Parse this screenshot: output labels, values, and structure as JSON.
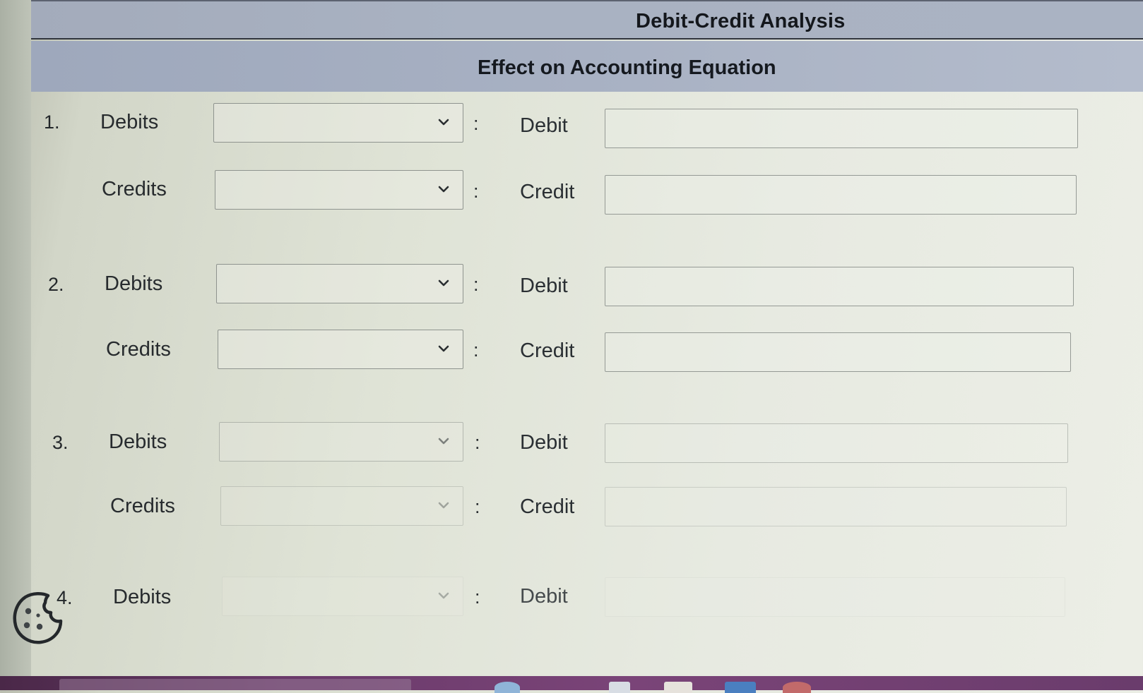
{
  "header": {
    "title": "Debit-Credit Analysis",
    "subtitle": "Effect on Accounting Equation"
  },
  "rows": [
    {
      "number": "1.",
      "debits_label": "Debits",
      "credits_label": "Credits",
      "debits_selected": "",
      "credits_selected": "",
      "separator": ":",
      "debit_label": "Debit",
      "credit_label": "Credit",
      "debit_value": "",
      "credit_value": ""
    },
    {
      "number": "2.",
      "debits_label": "Debits",
      "credits_label": "Credits",
      "debits_selected": "",
      "credits_selected": "",
      "separator": ":",
      "debit_label": "Debit",
      "credit_label": "Credit",
      "debit_value": "",
      "credit_value": ""
    },
    {
      "number": "3.",
      "debits_label": "Debits",
      "credits_label": "Credits",
      "debits_selected": "",
      "credits_selected": "",
      "separator": ":",
      "debit_label": "Debit",
      "credit_label": "Credit",
      "debit_value": "",
      "credit_value": ""
    },
    {
      "number": "4.",
      "debits_label": "Debits",
      "debits_selected": "",
      "separator": ":",
      "debit_label": "Debit",
      "debit_value": ""
    }
  ],
  "icons": {
    "dropdown": "chevron-down-icon",
    "cookie": "cookie-icon"
  },
  "colors": {
    "header_bar": "#a9b2c2",
    "text": "#272b2e",
    "taskbar": "#6a3a6a"
  }
}
